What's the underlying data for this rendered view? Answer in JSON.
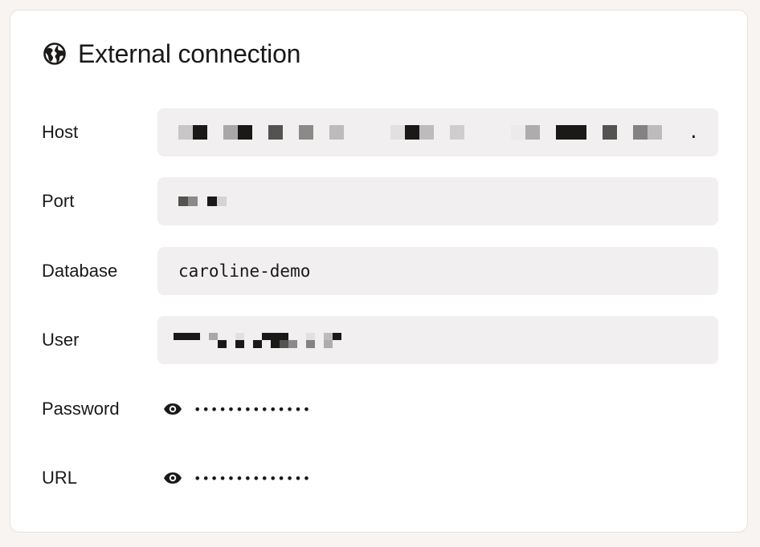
{
  "header": {
    "title": "External connection",
    "icon": "globe-icon"
  },
  "fields": {
    "host": {
      "label": "Host",
      "value_trailing": "."
    },
    "port": {
      "label": "Port"
    },
    "database": {
      "label": "Database",
      "value": "caroline-demo"
    },
    "user": {
      "label": "User"
    },
    "password": {
      "label": "Password",
      "masked": "••••••••••••••",
      "icon": "eye-icon"
    },
    "url": {
      "label": "URL",
      "masked": "••••••••••••••",
      "icon": "eye-icon"
    }
  },
  "colors": {
    "background": "#f8f4f1",
    "card": "#ffffff",
    "field_bg": "#f1efef",
    "text": "#1b1918"
  }
}
